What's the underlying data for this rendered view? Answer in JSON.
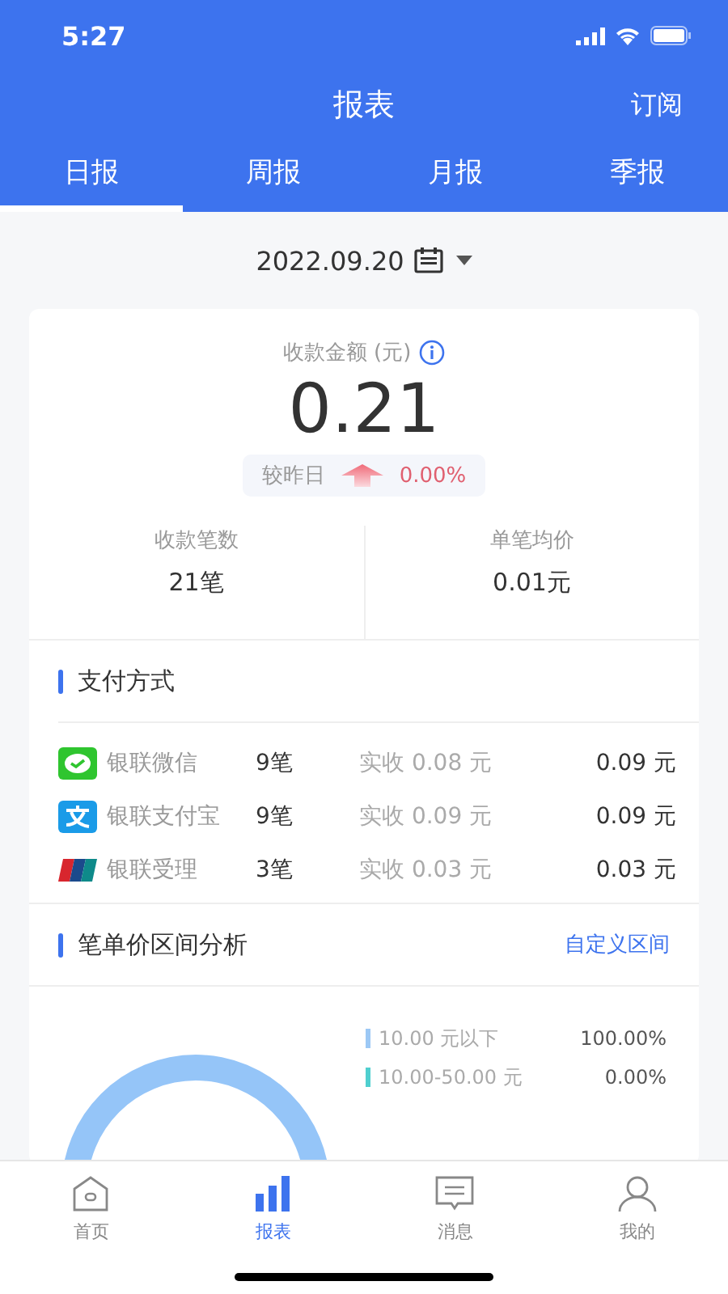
{
  "status_bar": {
    "time": "5:27"
  },
  "header": {
    "title": "报表",
    "action": "订阅"
  },
  "tabs": [
    {
      "label": "日报",
      "selected": true
    },
    {
      "label": "周报",
      "selected": false
    },
    {
      "label": "月报",
      "selected": false
    },
    {
      "label": "季报",
      "selected": false
    }
  ],
  "date": "2022.09.20",
  "summary": {
    "label": "收款金额 (元)",
    "amount": "0.21",
    "compare_label": "较昨日",
    "trend_up": true,
    "compare_value": "0.00%",
    "stats": [
      {
        "label": "收款笔数",
        "value": "21笔"
      },
      {
        "label": "单笔均价",
        "value": "0.01元"
      }
    ]
  },
  "payment_methods": {
    "title": "支付方式",
    "rows": [
      {
        "kind": "wechat",
        "name": "银联微信",
        "count": "9笔",
        "received": "实收 0.08 元",
        "amount": "0.09 元"
      },
      {
        "kind": "alipay",
        "name": "银联支付宝",
        "count": "9笔",
        "received": "实收 0.09 元",
        "amount": "0.09 元"
      },
      {
        "kind": "unionpay",
        "name": "银联受理",
        "count": "3笔",
        "received": "实收 0.03 元",
        "amount": "0.03 元"
      }
    ]
  },
  "price_ranges": {
    "title": "笔单价区间分析",
    "action": "自定义区间",
    "legend": [
      {
        "label": "10.00 元以下",
        "value": "100.00%",
        "color": "#9cc8f5"
      },
      {
        "label": "10.00-50.00 元",
        "value": "0.00%",
        "color": "#4fcfcf"
      }
    ]
  },
  "bottom_nav": [
    {
      "kind": "home",
      "label": "首页",
      "selected": false
    },
    {
      "kind": "chart",
      "label": "报表",
      "selected": true
    },
    {
      "kind": "message",
      "label": "消息",
      "selected": false
    },
    {
      "kind": "user",
      "label": "我的",
      "selected": false
    }
  ]
}
